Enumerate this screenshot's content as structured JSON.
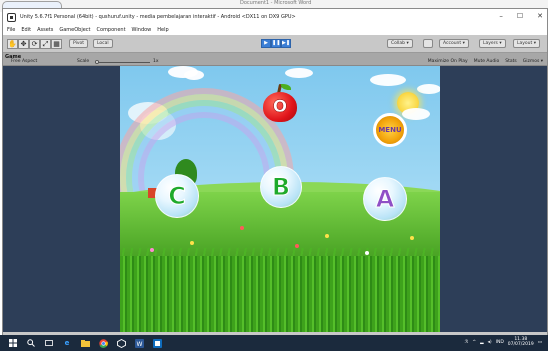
{
  "word": {
    "title": "Document1 - Microsoft Word"
  },
  "window": {
    "title": "Unity 5.6.7f1 Personal (64bit) - qushuruf.unity - media pembelajaran interaktif - Android <DX11 on DX9 GPU>",
    "controls": [
      "–",
      "☐",
      "✕"
    ]
  },
  "menu": [
    "File",
    "Edit",
    "Assets",
    "GameObject",
    "Component",
    "Window",
    "Help"
  ],
  "toolbar": {
    "tools": [
      "✋",
      "✥",
      "⟳",
      "⤢",
      "▦"
    ],
    "pivot": "Pivot",
    "local": "Local",
    "play": [
      "▶",
      "❚❚",
      "▶❚"
    ],
    "collab": "Collab ▾",
    "account": "Account ▾",
    "layers": "Layers ▾",
    "layout": "Layout ▾"
  },
  "game_panel": {
    "tab": "Game",
    "aspect": "Free Aspect",
    "scale_label": "Scale",
    "scale_value": "1x",
    "options": [
      "Maximize On Play",
      "Mute Audio",
      "Stats",
      "Gizmos ▾"
    ]
  },
  "game": {
    "apple_letter": "O",
    "menu_label": "MENU",
    "bubbles": [
      {
        "letter": "C",
        "color": "#1faa2b"
      },
      {
        "letter": "B",
        "color": "#1faa2b"
      },
      {
        "letter": "A",
        "color": "#8f4fc6"
      }
    ]
  },
  "taskbar": {
    "icons": [
      "windows-icon",
      "search-icon",
      "task-view-icon",
      "edge-icon",
      "explorer-icon",
      "chrome-icon",
      "unity-icon",
      "word-icon",
      "photos-icon"
    ],
    "lang": "IND",
    "time": "11.38",
    "date": "07/07/2019"
  }
}
